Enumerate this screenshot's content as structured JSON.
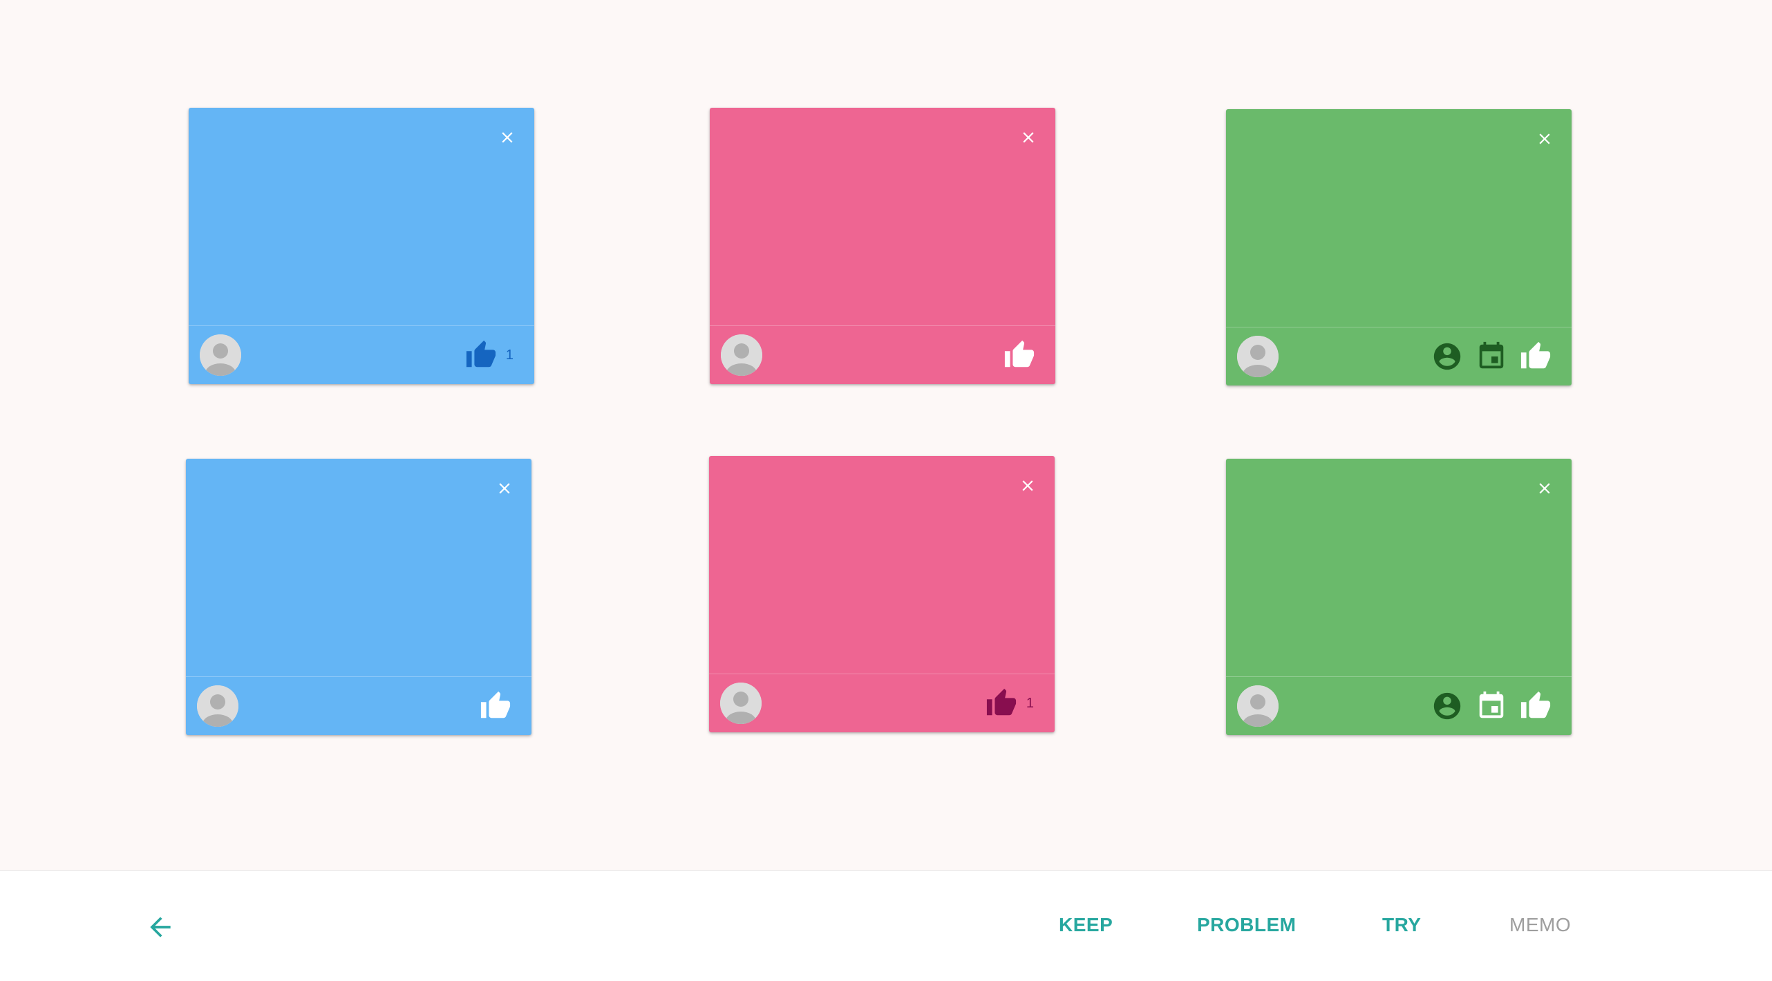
{
  "colors": {
    "blue_card": "#64b5f5",
    "pink_card": "#ee6592",
    "green_card": "#6aba6b",
    "accent_teal": "#27a79f",
    "memo_gray": "#9e9e9e",
    "liked_blue": "#1565c0",
    "liked_pink": "#880e4f",
    "green_icon_dark": "#1e5d22"
  },
  "cards": [
    {
      "column": "keep",
      "color": "blue",
      "liked": true,
      "like_count": "1",
      "icons": [
        "thumb-up-icon"
      ]
    },
    {
      "column": "problem",
      "color": "pink",
      "liked": false,
      "like_count": "",
      "icons": [
        "thumb-up-icon"
      ]
    },
    {
      "column": "try",
      "color": "green",
      "liked": false,
      "like_count": "",
      "icons": [
        "account-circle-icon",
        "calendar-icon",
        "thumb-up-icon"
      ]
    },
    {
      "column": "keep",
      "color": "blue",
      "liked": false,
      "like_count": "",
      "icons": [
        "thumb-up-icon"
      ]
    },
    {
      "column": "problem",
      "color": "pink",
      "liked": true,
      "like_count": "1",
      "icons": [
        "thumb-up-icon"
      ]
    },
    {
      "column": "try",
      "color": "green",
      "liked": false,
      "like_count": "",
      "icons": [
        "account-circle-icon",
        "calendar-icon",
        "thumb-up-icon"
      ]
    }
  ],
  "bottom_bar": {
    "back_icon": "arrow-back-icon",
    "buttons": {
      "keep": "KEEP",
      "problem": "PROBLEM",
      "try": "TRY",
      "memo": "MEMO"
    }
  }
}
